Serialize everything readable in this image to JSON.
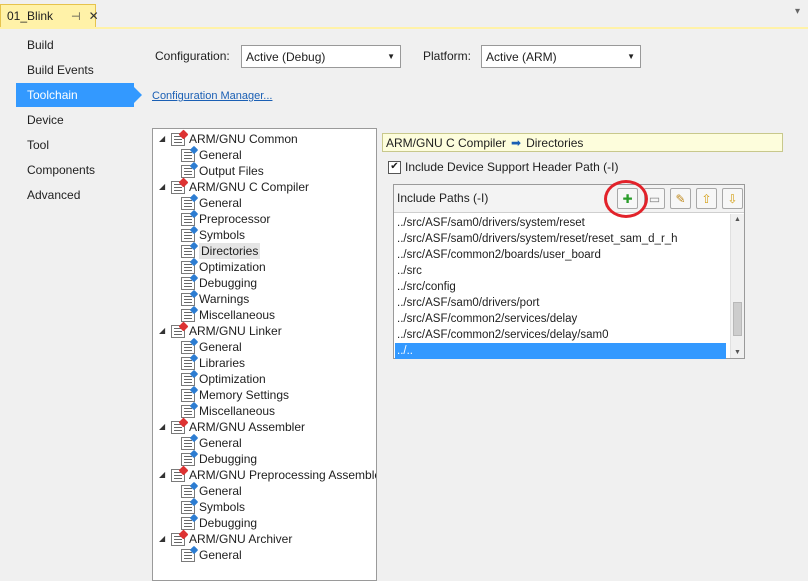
{
  "document_tab": {
    "title": "01_Blink",
    "pin_icon": "pin-icon",
    "close_icon": "close-icon"
  },
  "categories": [
    {
      "label": "Build",
      "selected": false
    },
    {
      "label": "Build Events",
      "selected": false
    },
    {
      "label": "Toolchain",
      "selected": true
    },
    {
      "label": "Device",
      "selected": false
    },
    {
      "label": "Tool",
      "selected": false
    },
    {
      "label": "Components",
      "selected": false
    },
    {
      "label": "Advanced",
      "selected": false
    }
  ],
  "configuration": {
    "label": "Configuration:",
    "value": "Active (Debug)"
  },
  "platform": {
    "label": "Platform:",
    "value": "Active (ARM)"
  },
  "config_manager_link": "Configuration Manager...",
  "tree": [
    {
      "label": "ARM/GNU Common",
      "level": 0,
      "selected": false
    },
    {
      "label": "General",
      "level": 1,
      "selected": false
    },
    {
      "label": "Output Files",
      "level": 1,
      "selected": false
    },
    {
      "label": "ARM/GNU C Compiler",
      "level": 0,
      "selected": false
    },
    {
      "label": "General",
      "level": 1,
      "selected": false
    },
    {
      "label": "Preprocessor",
      "level": 1,
      "selected": false
    },
    {
      "label": "Symbols",
      "level": 1,
      "selected": false
    },
    {
      "label": "Directories",
      "level": 1,
      "selected": true
    },
    {
      "label": "Optimization",
      "level": 1,
      "selected": false
    },
    {
      "label": "Debugging",
      "level": 1,
      "selected": false
    },
    {
      "label": "Warnings",
      "level": 1,
      "selected": false
    },
    {
      "label": "Miscellaneous",
      "level": 1,
      "selected": false
    },
    {
      "label": "ARM/GNU Linker",
      "level": 0,
      "selected": false
    },
    {
      "label": "General",
      "level": 1,
      "selected": false
    },
    {
      "label": "Libraries",
      "level": 1,
      "selected": false
    },
    {
      "label": "Optimization",
      "level": 1,
      "selected": false
    },
    {
      "label": "Memory Settings",
      "level": 1,
      "selected": false
    },
    {
      "label": "Miscellaneous",
      "level": 1,
      "selected": false
    },
    {
      "label": "ARM/GNU Assembler",
      "level": 0,
      "selected": false
    },
    {
      "label": "General",
      "level": 1,
      "selected": false
    },
    {
      "label": "Debugging",
      "level": 1,
      "selected": false
    },
    {
      "label": "ARM/GNU Preprocessing Assembler",
      "level": 0,
      "selected": false
    },
    {
      "label": "General",
      "level": 1,
      "selected": false
    },
    {
      "label": "Symbols",
      "level": 1,
      "selected": false
    },
    {
      "label": "Debugging",
      "level": 1,
      "selected": false
    },
    {
      "label": "ARM/GNU Archiver",
      "level": 0,
      "selected": false
    },
    {
      "label": "General",
      "level": 1,
      "selected": false
    }
  ],
  "breadcrumb": {
    "parent": "ARM/GNU C Compiler",
    "separator_icon": "arrow-right-icon",
    "current": "Directories"
  },
  "include_device_support": {
    "label": "Include Device Support Header Path (-I)",
    "checked": true
  },
  "include_paths": {
    "title": "Include Paths (-I)",
    "toolbar": [
      {
        "name": "add-item-button",
        "icon": "add-icon"
      },
      {
        "name": "delete-item-button",
        "icon": "delete-icon"
      },
      {
        "name": "edit-item-button",
        "icon": "edit-icon"
      },
      {
        "name": "move-up-button",
        "icon": "move-up-icon"
      },
      {
        "name": "move-down-button",
        "icon": "move-down-icon"
      }
    ],
    "items": [
      {
        "text": "../src/ASF/sam0/drivers/system/reset",
        "selected": false
      },
      {
        "text": "../src/ASF/sam0/drivers/system/reset/reset_sam_d_r_h",
        "selected": false
      },
      {
        "text": "../src/ASF/common2/boards/user_board",
        "selected": false
      },
      {
        "text": "../src",
        "selected": false
      },
      {
        "text": "../src/config",
        "selected": false
      },
      {
        "text": "../src/ASF/sam0/drivers/port",
        "selected": false
      },
      {
        "text": "../src/ASF/common2/services/delay",
        "selected": false
      },
      {
        "text": "../src/ASF/common2/services/delay/sam0",
        "selected": false
      },
      {
        "text": "../..",
        "selected": true
      }
    ]
  },
  "colors": {
    "selection": "#3399ff",
    "tab_accent": "#fff2a8",
    "highlight_circle": "#e2222a",
    "link": "#1a5fb4"
  }
}
